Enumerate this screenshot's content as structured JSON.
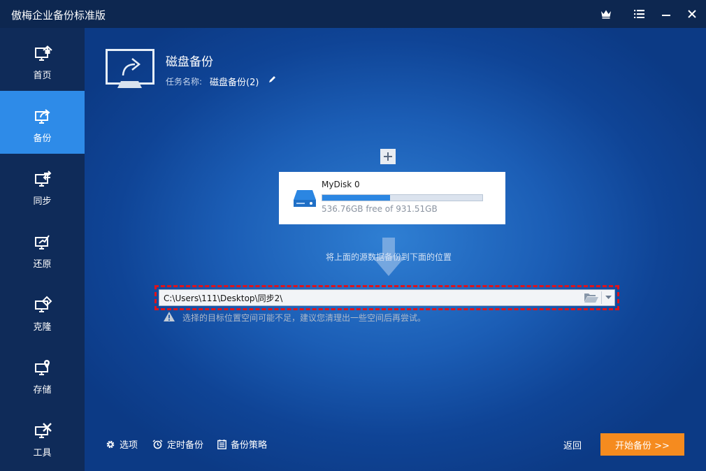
{
  "window": {
    "title": "傲梅企业备份标准版"
  },
  "titlebar_icons": [
    "crown-icon",
    "menu-icon",
    "minimize-icon",
    "close-icon"
  ],
  "sidebar": {
    "items": [
      {
        "label": "首页",
        "icon": "home-icon",
        "active": false
      },
      {
        "label": "备份",
        "icon": "backup-icon",
        "active": true
      },
      {
        "label": "同步",
        "icon": "sync-icon",
        "active": false
      },
      {
        "label": "还原",
        "icon": "restore-icon",
        "active": false
      },
      {
        "label": "克隆",
        "icon": "clone-icon",
        "active": false
      },
      {
        "label": "存储",
        "icon": "storage-icon",
        "active": false
      },
      {
        "label": "工具",
        "icon": "tools-icon",
        "active": false
      }
    ]
  },
  "header": {
    "title": "磁盘备份",
    "task_label": "任务名称:",
    "task_name": "磁盘备份(2)"
  },
  "source": {
    "disk_name": "MyDisk 0",
    "usage_fraction": 0.424,
    "free_text": "536.76GB free of 931.51GB"
  },
  "flow_hint": "将上面的源数据备份到下面的位置",
  "destination": {
    "path": "C:\\Users\\111\\Desktop\\同步2\\"
  },
  "warning": "选择的目标位置空间可能不足，建议您清理出一些空间后再尝试。",
  "footer": {
    "options_label": "选项",
    "schedule_label": "定时备份",
    "scheme_label": "备份策略",
    "back_label": "返回",
    "start_label": "开始备份 >>"
  },
  "colors": {
    "accent": "#2e8be8",
    "start_button": "#f58b1f",
    "highlight_border": "#e0121a",
    "sidebar_bg": "#0f2b59",
    "titlebar_bg": "#0d2750"
  }
}
